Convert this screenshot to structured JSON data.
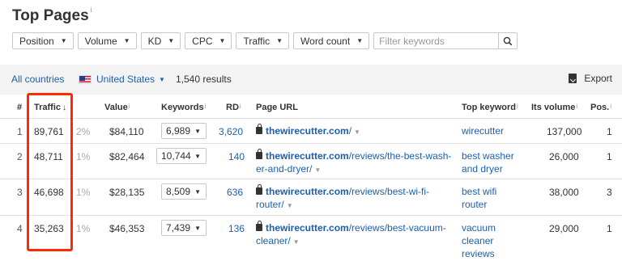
{
  "page_title": "Top Pages",
  "title_info": "i",
  "filters": [
    {
      "label": "Position"
    },
    {
      "label": "Volume"
    },
    {
      "label": "KD"
    },
    {
      "label": "CPC"
    },
    {
      "label": "Traffic"
    },
    {
      "label": "Word count"
    }
  ],
  "search": {
    "placeholder": "Filter keywords"
  },
  "toolbar": {
    "all_countries": "All countries",
    "country": "United States",
    "results": "1,540 results",
    "export": "Export"
  },
  "columns": {
    "num": "#",
    "traffic": "Traffic",
    "traffic_sort": "↓",
    "value": "Value",
    "keywords": "Keywords",
    "rd": "RD",
    "page_url": "Page URL",
    "top_keyword": "Top keyword",
    "volume": "Its volume",
    "pos": "Pos.",
    "info": "i"
  },
  "rows": [
    {
      "n": "1",
      "traffic": "89,761",
      "pct": "2%",
      "value": "$84,110",
      "keywords": "6,989",
      "rd": "3,620",
      "url_domain": "thewirecutter.com",
      "url_line1": "/",
      "url_line2": "",
      "top_kw_1": "wirecutter",
      "top_kw_2": "",
      "top_kw_3": "",
      "volume": "137,000",
      "pos": "1"
    },
    {
      "n": "2",
      "traffic": "48,711",
      "pct": "1%",
      "value": "$82,464",
      "keywords": "10,744",
      "rd": "140",
      "url_domain": "thewirecutter.com",
      "url_line1": "/reviews/the-best-wash-",
      "url_line2": "er-and-dryer/",
      "top_kw_1": "best washer",
      "top_kw_2": "and dryer",
      "top_kw_3": "",
      "volume": "26,000",
      "pos": "1"
    },
    {
      "n": "3",
      "traffic": "46,698",
      "pct": "1%",
      "value": "$28,135",
      "keywords": "8,509",
      "rd": "636",
      "url_domain": "thewirecutter.com",
      "url_line1": "/reviews/best-wi-fi-",
      "url_line2": "router/",
      "top_kw_1": "best wifi",
      "top_kw_2": "router",
      "top_kw_3": "",
      "volume": "38,000",
      "pos": "3"
    },
    {
      "n": "4",
      "traffic": "35,263",
      "pct": "1%",
      "value": "$46,353",
      "keywords": "7,439",
      "rd": "136",
      "url_domain": "thewirecutter.com",
      "url_line1": "/reviews/best-vacuum-",
      "url_line2": "cleaner/",
      "top_kw_1": "vacuum",
      "top_kw_2": "cleaner",
      "top_kw_3": "reviews",
      "volume": "29,000",
      "pos": "1"
    }
  ],
  "colors": {
    "link": "#1a5fb4",
    "highlight": "#ff2a00"
  }
}
